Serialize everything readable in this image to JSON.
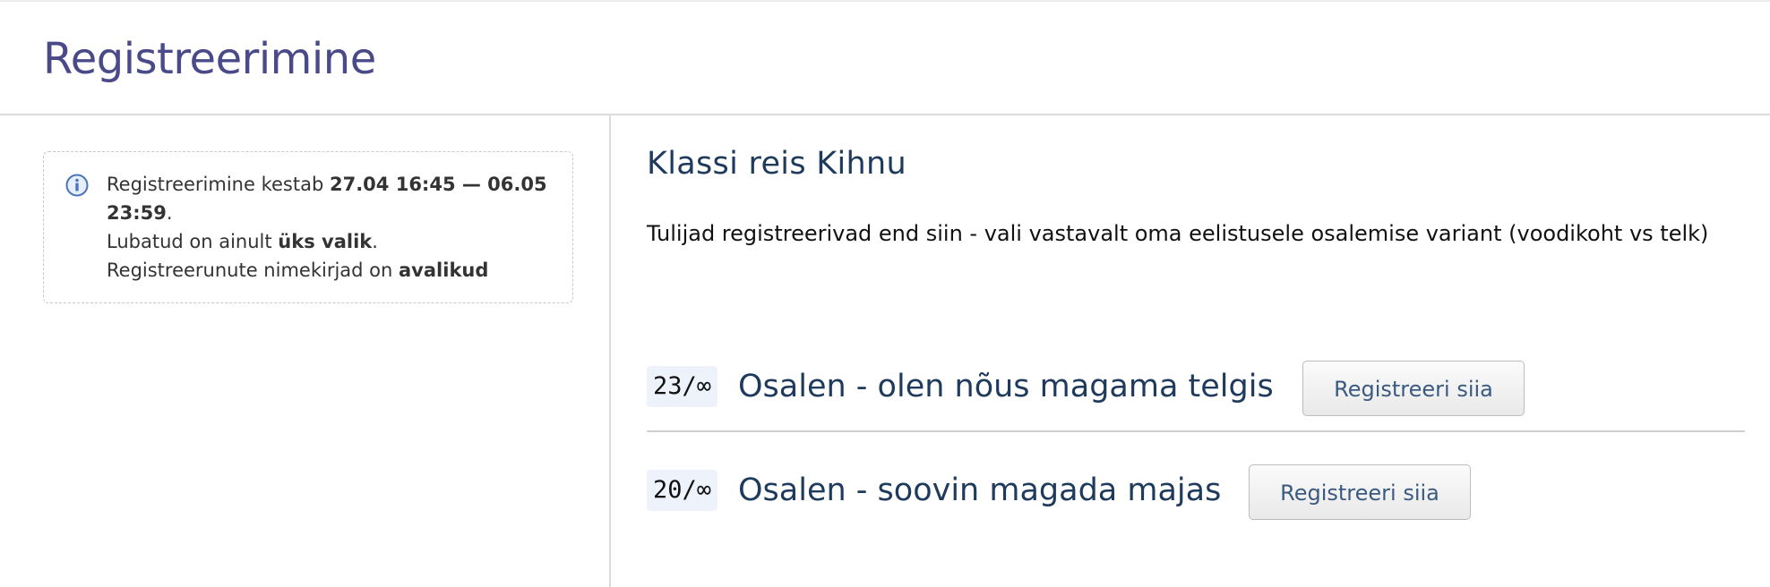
{
  "page": {
    "title": "Registreerimine"
  },
  "info": {
    "icon": "info-icon",
    "line1_prefix": "Registreerimine kestab ",
    "period": "27.04 16:45 — 06.05 23:59",
    "line1_suffix": ".",
    "line2_prefix": "Lubatud on ainult ",
    "choice_rule": "üks valik",
    "line2_suffix": ".",
    "line3_prefix": "Registreerunute nimekirjad on ",
    "visibility": "avalikud"
  },
  "event": {
    "title": "Klassi reis Kihnu",
    "description": "Tulijad registreerivad end siin - vali vastavalt oma eelistusele osalemise variant (voodikoht vs telk)"
  },
  "options": [
    {
      "count": "23/∞",
      "label": "Osalen - olen nõus magama telgis",
      "button_label": "Registreeri siia"
    },
    {
      "count": "20/∞",
      "label": "Osalen - soovin magada majas",
      "button_label": "Registreeri siia"
    }
  ],
  "colors": {
    "title": "#4a4a8a",
    "heading": "#1e3a5c",
    "counter_bg": "#eef2fb",
    "info_icon": "#4a76b8"
  }
}
